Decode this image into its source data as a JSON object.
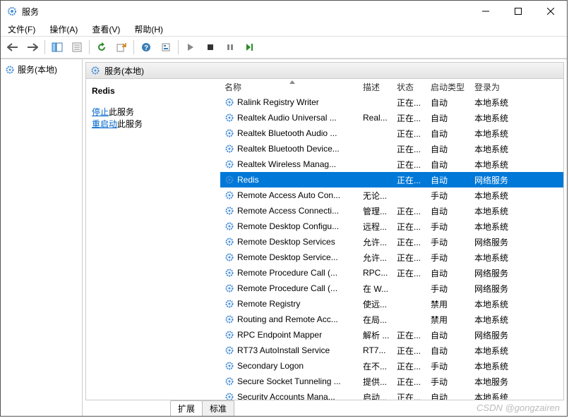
{
  "window": {
    "title": "服务"
  },
  "menubar": {
    "file": "文件(F)",
    "action": "操作(A)",
    "view": "查看(V)",
    "help": "帮助(H)"
  },
  "toolbar_icons": [
    "back",
    "forward",
    "show-hide",
    "props",
    "export",
    "refresh",
    "export2",
    "help",
    "prev",
    "play",
    "stop",
    "pause",
    "restart"
  ],
  "left": {
    "item": "服务(本地)"
  },
  "panel": {
    "header": "服务(本地)"
  },
  "detail": {
    "selected_name": "Redis",
    "stop_link": "停止",
    "stop_suffix": "此服务",
    "restart_link": "重启动",
    "restart_suffix": "此服务"
  },
  "columns": {
    "name": "名称",
    "desc": "描述",
    "status": "状态",
    "startup": "启动类型",
    "logon": "登录为"
  },
  "colwidths": {
    "name": 196,
    "desc": 48,
    "status": 48,
    "startup": 62,
    "logon": 80
  },
  "services": [
    {
      "name": "Ralink Registry Writer",
      "desc": "",
      "status": "正在...",
      "startup": "自动",
      "logon": "本地系统",
      "sel": false
    },
    {
      "name": "Realtek Audio Universal ...",
      "desc": "Real...",
      "status": "正在...",
      "startup": "自动",
      "logon": "本地系统",
      "sel": false
    },
    {
      "name": "Realtek Bluetooth Audio ...",
      "desc": "",
      "status": "正在...",
      "startup": "自动",
      "logon": "本地系统",
      "sel": false
    },
    {
      "name": "Realtek Bluetooth Device...",
      "desc": "",
      "status": "正在...",
      "startup": "自动",
      "logon": "本地系统",
      "sel": false
    },
    {
      "name": "Realtek Wireless Manag...",
      "desc": "",
      "status": "正在...",
      "startup": "自动",
      "logon": "本地系统",
      "sel": false
    },
    {
      "name": "Redis",
      "desc": "",
      "status": "正在...",
      "startup": "自动",
      "logon": "网络服务",
      "sel": true
    },
    {
      "name": "Remote Access Auto Con...",
      "desc": "无论...",
      "status": "",
      "startup": "手动",
      "logon": "本地系统",
      "sel": false
    },
    {
      "name": "Remote Access Connecti...",
      "desc": "管理...",
      "status": "正在...",
      "startup": "自动",
      "logon": "本地系统",
      "sel": false
    },
    {
      "name": "Remote Desktop Configu...",
      "desc": "远程...",
      "status": "正在...",
      "startup": "手动",
      "logon": "本地系统",
      "sel": false
    },
    {
      "name": "Remote Desktop Services",
      "desc": "允许...",
      "status": "正在...",
      "startup": "手动",
      "logon": "网络服务",
      "sel": false
    },
    {
      "name": "Remote Desktop Service...",
      "desc": "允许...",
      "status": "正在...",
      "startup": "手动",
      "logon": "本地系统",
      "sel": false
    },
    {
      "name": "Remote Procedure Call (...",
      "desc": "RPC...",
      "status": "正在...",
      "startup": "自动",
      "logon": "网络服务",
      "sel": false
    },
    {
      "name": "Remote Procedure Call (...",
      "desc": "在 W...",
      "status": "",
      "startup": "手动",
      "logon": "网络服务",
      "sel": false
    },
    {
      "name": "Remote Registry",
      "desc": "使远...",
      "status": "",
      "startup": "禁用",
      "logon": "本地系统",
      "sel": false
    },
    {
      "name": "Routing and Remote Acc...",
      "desc": "在局...",
      "status": "",
      "startup": "禁用",
      "logon": "本地系统",
      "sel": false
    },
    {
      "name": "RPC Endpoint Mapper",
      "desc": "解析 ...",
      "status": "正在...",
      "startup": "自动",
      "logon": "网络服务",
      "sel": false
    },
    {
      "name": "RT73 AutoInstall Service",
      "desc": "RT7...",
      "status": "正在...",
      "startup": "自动",
      "logon": "本地系统",
      "sel": false
    },
    {
      "name": "Secondary Logon",
      "desc": "在不...",
      "status": "正在...",
      "startup": "手动",
      "logon": "本地系统",
      "sel": false
    },
    {
      "name": "Secure Socket Tunneling ...",
      "desc": "提供...",
      "status": "正在...",
      "startup": "手动",
      "logon": "本地服务",
      "sel": false
    },
    {
      "name": "Security Accounts Mana...",
      "desc": "启动...",
      "status": "正在...",
      "startup": "自动",
      "logon": "本地系统",
      "sel": false
    }
  ],
  "tabs": {
    "ext": "扩展",
    "std": "标准"
  },
  "watermark": "CSDN @gongzairen"
}
